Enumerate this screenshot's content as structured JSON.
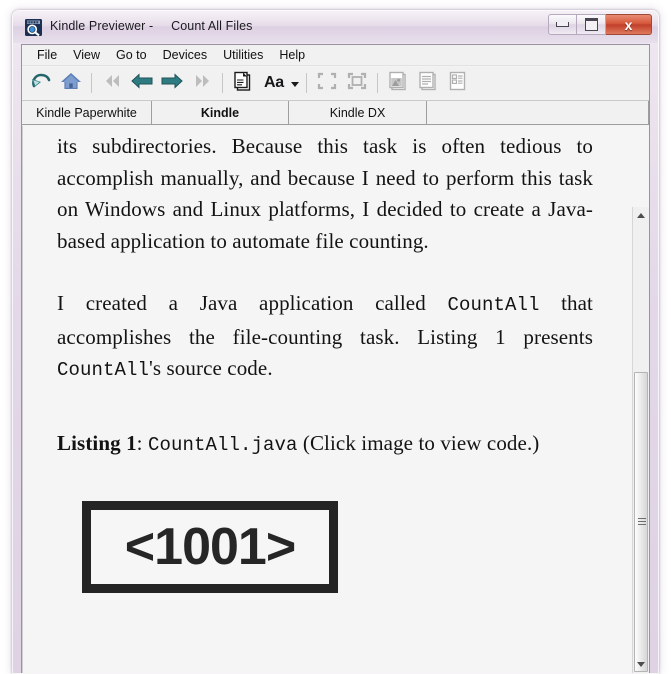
{
  "window": {
    "app_icon": "kindle-previewer-icon",
    "title": "Kindle Previewer -     Count All Files",
    "controls": {
      "minimize": "minimize-button",
      "maximize": "maximize-button",
      "close_label": "x"
    }
  },
  "menubar": {
    "items": [
      {
        "label": "File"
      },
      {
        "label": "View"
      },
      {
        "label": "Go to"
      },
      {
        "label": "Devices"
      },
      {
        "label": "Utilities"
      },
      {
        "label": "Help"
      }
    ]
  },
  "toolbar": {
    "buttons": [
      {
        "name": "refresh-icon",
        "enabled": true
      },
      {
        "name": "home-icon",
        "enabled": true
      },
      {
        "name": "first-page-icon",
        "enabled": false
      },
      {
        "name": "previous-page-icon",
        "enabled": true
      },
      {
        "name": "next-page-icon",
        "enabled": true
      },
      {
        "name": "last-page-icon",
        "enabled": false
      },
      {
        "name": "pages-icon",
        "enabled": true
      }
    ],
    "font_button_label": "Aa",
    "right_buttons": [
      {
        "name": "fit-page-icon",
        "enabled": false
      },
      {
        "name": "actual-size-icon",
        "enabled": false
      },
      {
        "name": "image-view-icon",
        "enabled": false
      },
      {
        "name": "text-view-icon",
        "enabled": false
      },
      {
        "name": "layout-view-icon",
        "enabled": false
      }
    ]
  },
  "tabs": [
    {
      "label": "Kindle Paperwhite",
      "active": false
    },
    {
      "label": "Kindle",
      "active": true
    },
    {
      "label": "Kindle DX",
      "active": false
    }
  ],
  "content": {
    "paragraph_1": "its subdirectories. Because this task is often tedious to accomplish manually, and because I need to perform this task on Windows and Linux platforms, I decided to create a Java-based application to automate file counting.",
    "paragraph_2_part_1": "I created a Java application called ",
    "paragraph_2_code_1": "CountAll",
    "paragraph_2_part_2": " that accomplishes the file-counting task. Listing 1 presents ",
    "paragraph_2_code_2": "CountAll",
    "paragraph_2_part_3": "'s source code.",
    "listing_label": "Listing 1",
    "listing_colon": ": ",
    "listing_code": "CountAll.java",
    "listing_note": " (Click image to view code.)",
    "image_placeholder_text": "<1001>"
  },
  "scrollbar": {
    "up_arrow": "scroll-up-arrow",
    "down_arrow": "scroll-down-arrow",
    "thumb": "scroll-thumb"
  },
  "colors": {
    "titlebar": "#e3d7e7",
    "close_button": "#c1402a",
    "content_bg": "#f5f5f5",
    "chrome_bg": "#f1f1f1",
    "toolbar_accent": "#2d7d82"
  }
}
